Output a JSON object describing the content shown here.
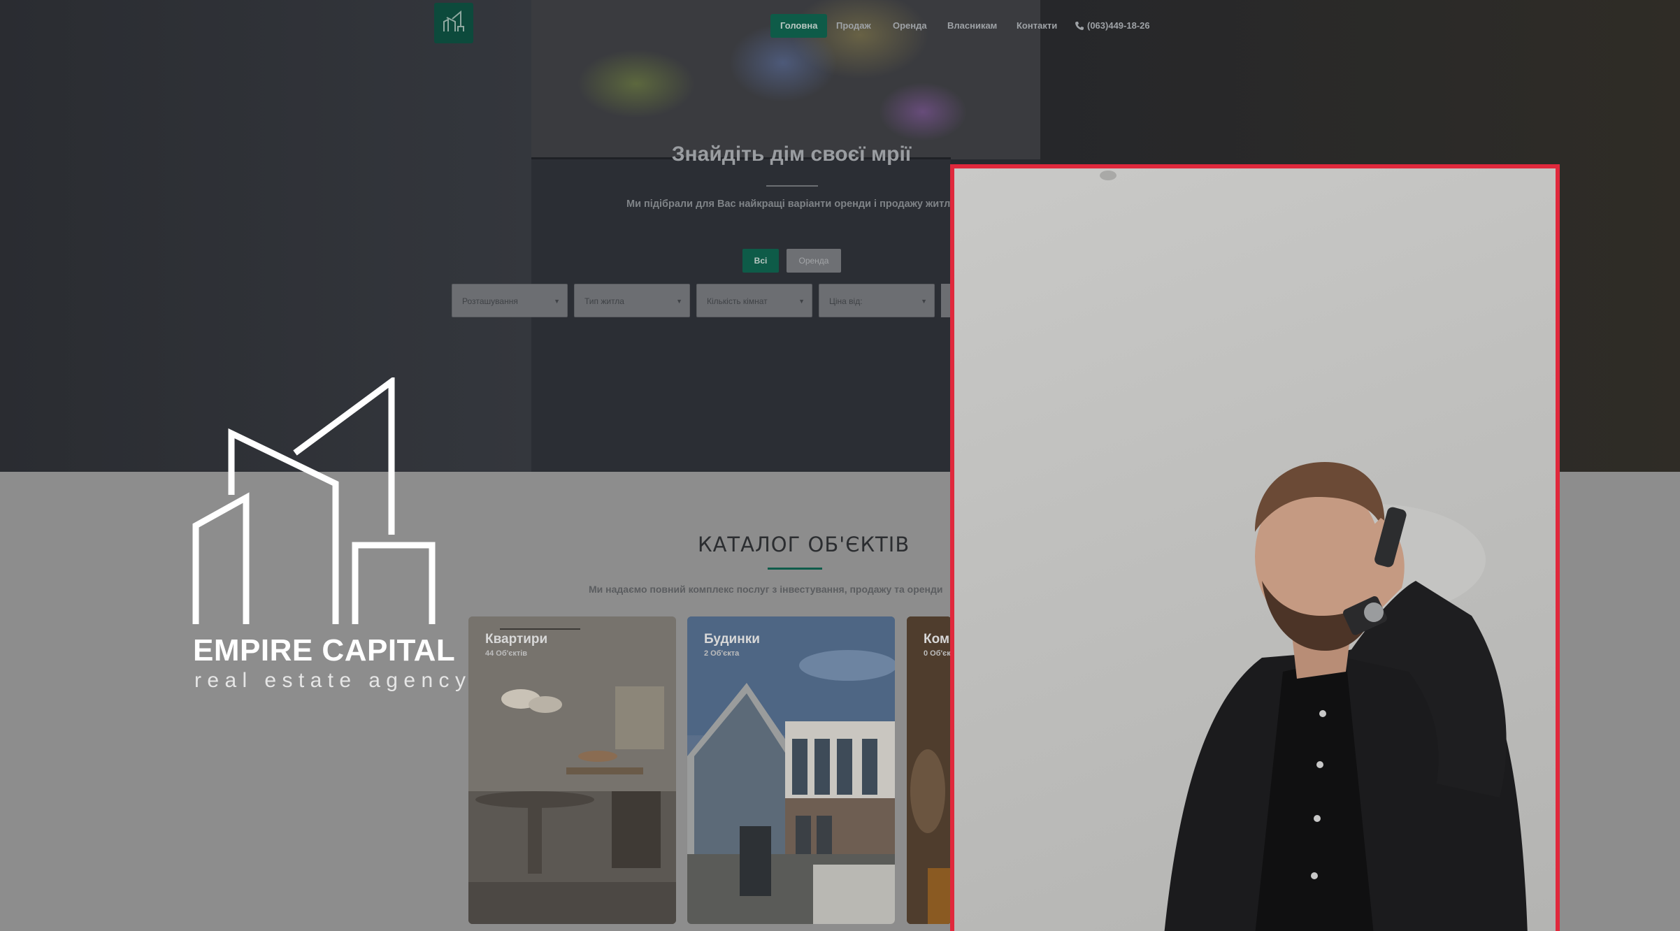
{
  "nav": {
    "items": [
      "Головна",
      "Продаж",
      "Оренда",
      "Власникам",
      "Контакти"
    ],
    "active_index": 0,
    "phone": "(063)449-18-26"
  },
  "hero": {
    "title": "Знайдіть дім своєї мрії",
    "subtitle": "Ми підібрали для Вас найкращі варіанти оренди і продажу житла",
    "tabs": {
      "all": "Всі",
      "rent": "Оренда"
    },
    "filters": [
      "Розташування",
      "Тип житла",
      "Кількість кімнат",
      "Ціна від:"
    ]
  },
  "catalog": {
    "title": "КАТАЛОГ ОБ'ЄКТІВ",
    "subtitle": "Ми надаємо повний комплекс послуг з інвестування, продажу та оренди",
    "cards": [
      {
        "title": "Квартири",
        "count": "44 Об'єктів"
      },
      {
        "title": "Будинки",
        "count": "2 Об'єкта"
      },
      {
        "title": "Ком",
        "count": "0 Об'єк"
      }
    ]
  },
  "brand": {
    "name": "EMPIRE CAPITAL",
    "tagline": "real estate agency"
  },
  "colors": {
    "accent": "#0e5b48",
    "frame": "#e0283c",
    "background": "#8d8d8d"
  }
}
